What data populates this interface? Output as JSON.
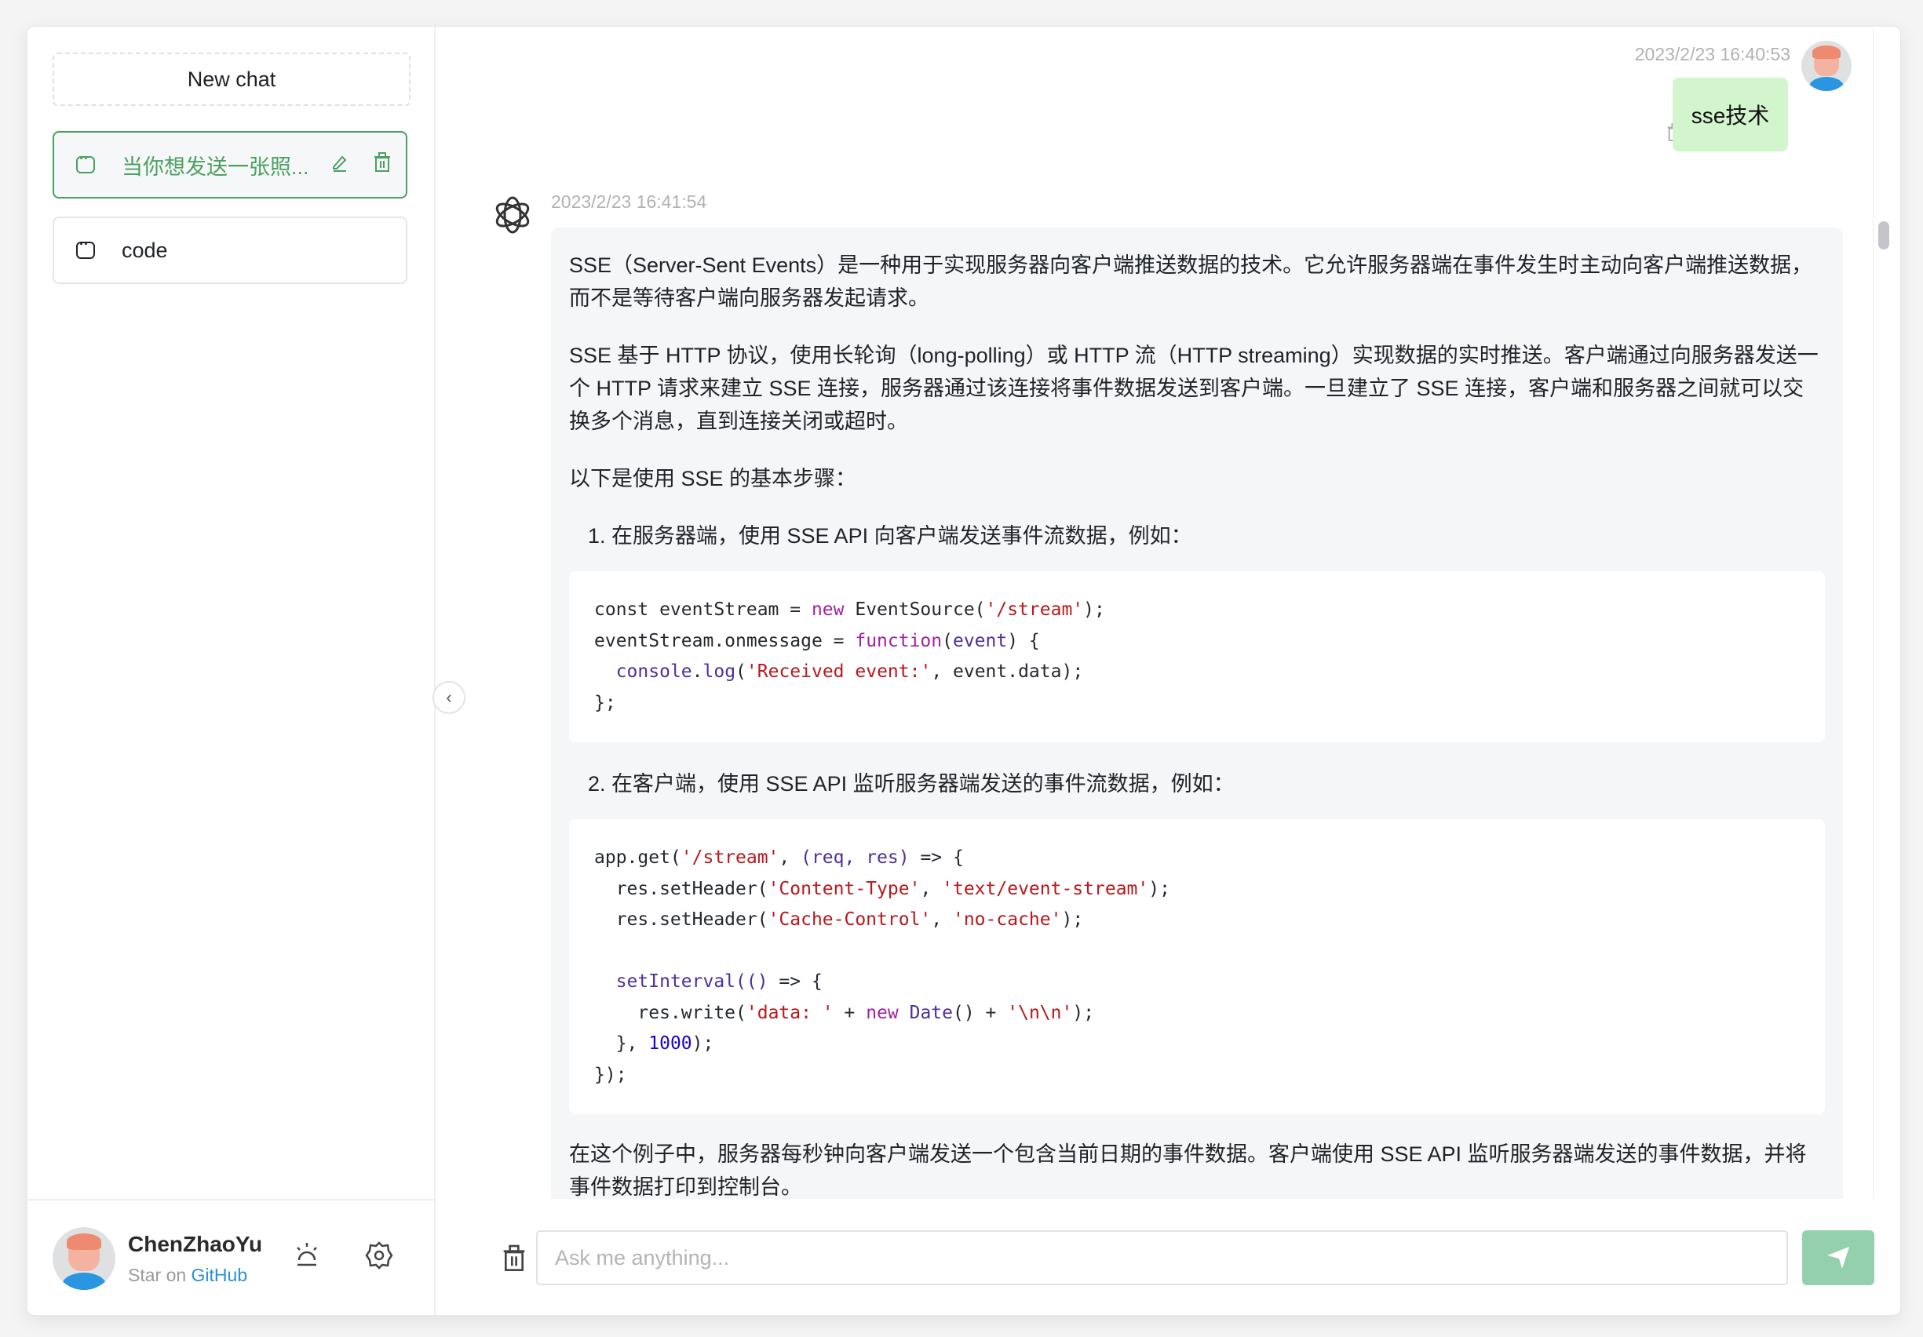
{
  "sidebar": {
    "new_chat": "New chat",
    "history": [
      {
        "label": "当你想发送一张照...",
        "active": true
      },
      {
        "label": "code",
        "active": false
      }
    ],
    "user": {
      "name": "ChenZhaoYu",
      "star_prefix": "Star on",
      "github": "GitHub"
    }
  },
  "chat": {
    "user_message": {
      "timestamp": "2023/2/23 16:40:53",
      "text": "sse技术"
    },
    "ai_message": {
      "timestamp": "2023/2/23 16:41:54",
      "p1": "SSE（Server-Sent Events）是一种用于实现服务器向客户端推送数据的技术。它允许服务器端在事件发生时主动向客户端推送数据，而不是等待客户端向服务器发起请求。",
      "p2": "SSE 基于 HTTP 协议，使用长轮询（long-polling）或 HTTP 流（HTTP streaming）实现数据的实时推送。客户端通过向服务器发送一个 HTTP 请求来建立 SSE 连接，服务器通过该连接将事件数据发送到客户端。一旦建立了 SSE 连接，客户端和服务器之间就可以交换多个消息，直到连接关闭或超时。",
      "p3": "以下是使用 SSE 的基本步骤：",
      "step1": "1. 在服务器端，使用 SSE API 向客户端发送事件流数据，例如：",
      "code1": [
        [
          [
            "const eventStream = ",
            "p"
          ],
          [
            "new",
            "k"
          ],
          [
            " EventSource(",
            "p"
          ],
          [
            "'/stream'",
            "s"
          ],
          [
            ");",
            "p"
          ]
        ],
        [
          [
            "eventStream.onmessage = ",
            "p"
          ],
          [
            "function",
            "k"
          ],
          [
            "(",
            "p"
          ],
          [
            "event",
            "f"
          ],
          [
            ") {",
            "p"
          ]
        ],
        [
          [
            "  ",
            "p"
          ],
          [
            "console",
            "f"
          ],
          [
            ".",
            "p"
          ],
          [
            "log",
            "f"
          ],
          [
            "(",
            "p"
          ],
          [
            "'Received event:'",
            "s"
          ],
          [
            ", event.data);",
            "p"
          ]
        ],
        [
          [
            "};",
            "p"
          ]
        ]
      ],
      "step2": "2. 在客户端，使用 SSE API 监听服务器端发送的事件流数据，例如：",
      "code2": [
        [
          [
            "app.get(",
            "p"
          ],
          [
            "'/stream'",
            "s"
          ],
          [
            ", ",
            "p"
          ],
          [
            "(req, res)",
            "f"
          ],
          [
            " => {",
            "p"
          ]
        ],
        [
          [
            "  res.setHeader(",
            "p"
          ],
          [
            "'Content-Type'",
            "s"
          ],
          [
            ", ",
            "p"
          ],
          [
            "'text/event-stream'",
            "s"
          ],
          [
            ");",
            "p"
          ]
        ],
        [
          [
            "  res.setHeader(",
            "p"
          ],
          [
            "'Cache-Control'",
            "s"
          ],
          [
            ", ",
            "p"
          ],
          [
            "'no-cache'",
            "s"
          ],
          [
            ");",
            "p"
          ]
        ],
        [
          [
            "",
            "p"
          ]
        ],
        [
          [
            "  ",
            "p"
          ],
          [
            "setInterval(()",
            "f"
          ],
          [
            " => {",
            "p"
          ]
        ],
        [
          [
            "    res.write(",
            "p"
          ],
          [
            "'data: '",
            "s"
          ],
          [
            " + ",
            "p"
          ],
          [
            "new",
            "k"
          ],
          [
            " ",
            "p"
          ],
          [
            "Date",
            "f"
          ],
          [
            "() + ",
            "p"
          ],
          [
            "'\\n\\n'",
            "s"
          ],
          [
            ");",
            "p"
          ]
        ],
        [
          [
            "  }, ",
            "p"
          ],
          [
            "1000",
            "n"
          ],
          [
            ");",
            "p"
          ]
        ],
        [
          [
            "});",
            "p"
          ]
        ]
      ],
      "p4": "在这个例子中，服务器每秒钟向客户端发送一个包含当前日期的事件数据。客户端使用 SSE API 监听服务器端发送的事件数据，并将事件数据打印到控制台。"
    }
  },
  "input": {
    "placeholder": "Ask me anything...",
    "value": ""
  },
  "colors": {
    "accent": "#4aa061",
    "user_bubble": "#d3f5cd",
    "send_button": "#94d0ae",
    "github_link": "#2b8fd6"
  },
  "icons": [
    "chat-icon",
    "edit-icon",
    "trash-icon",
    "sun-icon",
    "gear-icon",
    "chevron-left-icon",
    "openai-logo-icon",
    "send-icon"
  ]
}
